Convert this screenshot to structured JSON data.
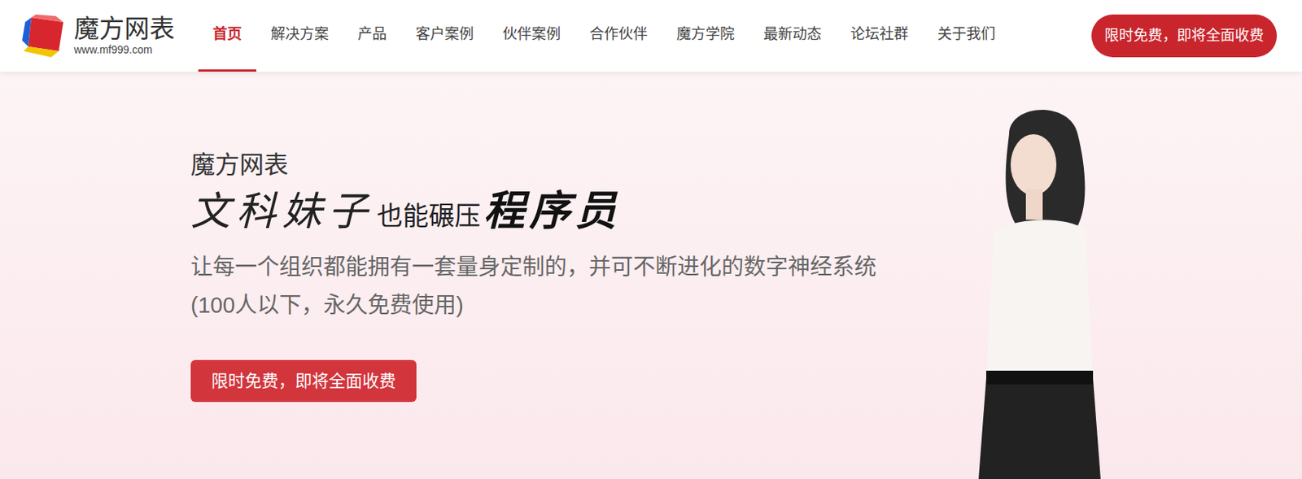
{
  "logo": {
    "name": "魔方网表",
    "url": "www.mf999.com"
  },
  "nav": [
    {
      "label": "首页",
      "selected": true
    },
    {
      "label": "解决方案",
      "selected": false
    },
    {
      "label": "产品",
      "selected": false
    },
    {
      "label": "客户案例",
      "selected": false
    },
    {
      "label": "伙伴案例",
      "selected": false
    },
    {
      "label": "合作伙伴",
      "selected": false
    },
    {
      "label": "魔方学院",
      "selected": false
    },
    {
      "label": "最新动态",
      "selected": false
    },
    {
      "label": "论坛社群",
      "selected": false
    },
    {
      "label": "关于我们",
      "selected": false
    }
  ],
  "header_button": "限时免费，即将全面收费",
  "hero": {
    "brand": "魔方网表",
    "slogan": {
      "script": "文科妹子",
      "middle": "也能碾压",
      "bold": "程序员"
    },
    "description": "让每一个组织都能拥有一套量身定制的，并可不断进化的数字神经系统",
    "note": "(100人以下，永久免费使用)",
    "button": "限时免费，即将全面收费"
  }
}
